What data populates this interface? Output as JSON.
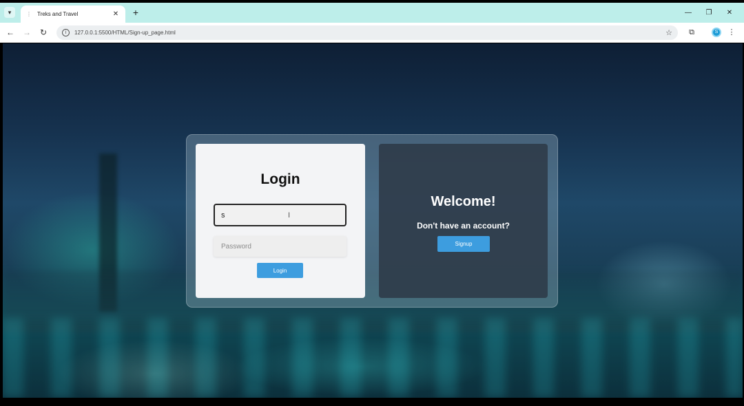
{
  "browser": {
    "tab_title": "Treks and Travel",
    "url": "127.0.0.1:5500/HTML/Sign-up_page.html",
    "profile_initial": "S"
  },
  "login": {
    "title": "Login",
    "username_value": "s",
    "password_placeholder": "Password",
    "button_label": "Login"
  },
  "welcome": {
    "title": "Welcome!",
    "subtitle": "Don't have an account?",
    "button_label": "Signup"
  },
  "colors": {
    "tabbar": "#bdeeea",
    "button": "#3d9ddf",
    "welcome_card": "#2d3a48"
  }
}
